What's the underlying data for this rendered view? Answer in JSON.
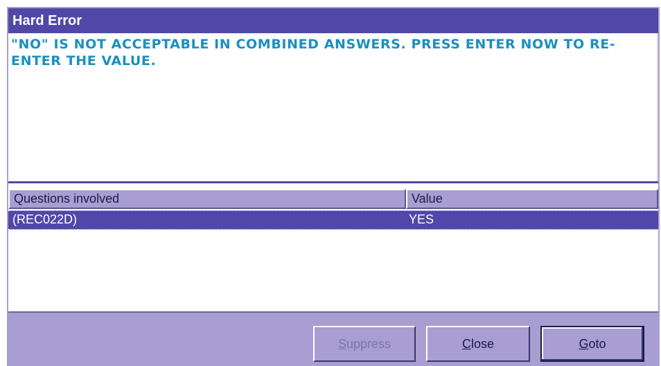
{
  "dialog": {
    "title": "Hard Error",
    "message": "\"NO\" IS NOT ACCEPTABLE IN COMBINED ANSWERS. PRESS ENTER NOW TO RE-ENTER THE VALUE."
  },
  "grid": {
    "columns": [
      "Questions involved",
      "Value"
    ],
    "rows": [
      {
        "question": "(REC022D)",
        "value": "YES"
      }
    ]
  },
  "buttons": {
    "suppress": {
      "hotkey": "S",
      "rest": "uppress",
      "enabled": false
    },
    "close": {
      "hotkey": "C",
      "rest": "lose"
    },
    "goto": {
      "hotkey": "G",
      "rest": "oto"
    }
  },
  "colors": {
    "title_bar": "#5048a8",
    "dialog_background": "#a89ed2",
    "message_text": "#1a8fc0",
    "selected_row": "#5048a8"
  }
}
